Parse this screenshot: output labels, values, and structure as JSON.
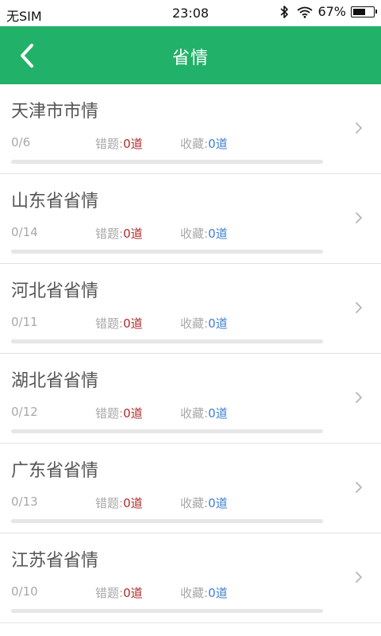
{
  "status_bar": {
    "carrier": "无SIM",
    "time": "23:08",
    "battery_text": "67%",
    "battery_level": 0.67
  },
  "nav": {
    "title": "省情"
  },
  "items": [
    {
      "title": "天津市市情",
      "progress": "0/6",
      "wrong_label": "错题:",
      "wrong_value": "0道",
      "fav_label": "收藏:",
      "fav_value": "0道",
      "progress_fraction": 0
    },
    {
      "title": "山东省省情",
      "progress": "0/14",
      "wrong_label": "错题:",
      "wrong_value": "0道",
      "fav_label": "收藏:",
      "fav_value": "0道",
      "progress_fraction": 0
    },
    {
      "title": "河北省省情",
      "progress": "0/11",
      "wrong_label": "错题:",
      "wrong_value": "0道",
      "fav_label": "收藏:",
      "fav_value": "0道",
      "progress_fraction": 0
    },
    {
      "title": "湖北省省情",
      "progress": "0/12",
      "wrong_label": "错题:",
      "wrong_value": "0道",
      "fav_label": "收藏:",
      "fav_value": "0道",
      "progress_fraction": 0
    },
    {
      "title": "广东省省情",
      "progress": "0/13",
      "wrong_label": "错题:",
      "wrong_value": "0道",
      "fav_label": "收藏:",
      "fav_value": "0道",
      "progress_fraction": 0
    },
    {
      "title": "江苏省省情",
      "progress": "0/10",
      "wrong_label": "错题:",
      "wrong_value": "0道",
      "fav_label": "收藏:",
      "fav_value": "0道",
      "progress_fraction": 0
    }
  ],
  "colors": {
    "accent": "#22b168",
    "wrong": "#b22a2a",
    "favorite": "#3f7fcf"
  },
  "icons": {
    "back": "chevron-left-icon",
    "row": "chevron-right-icon",
    "bluetooth": "bluetooth-icon",
    "wifi": "wifi-icon",
    "battery": "battery-icon"
  }
}
